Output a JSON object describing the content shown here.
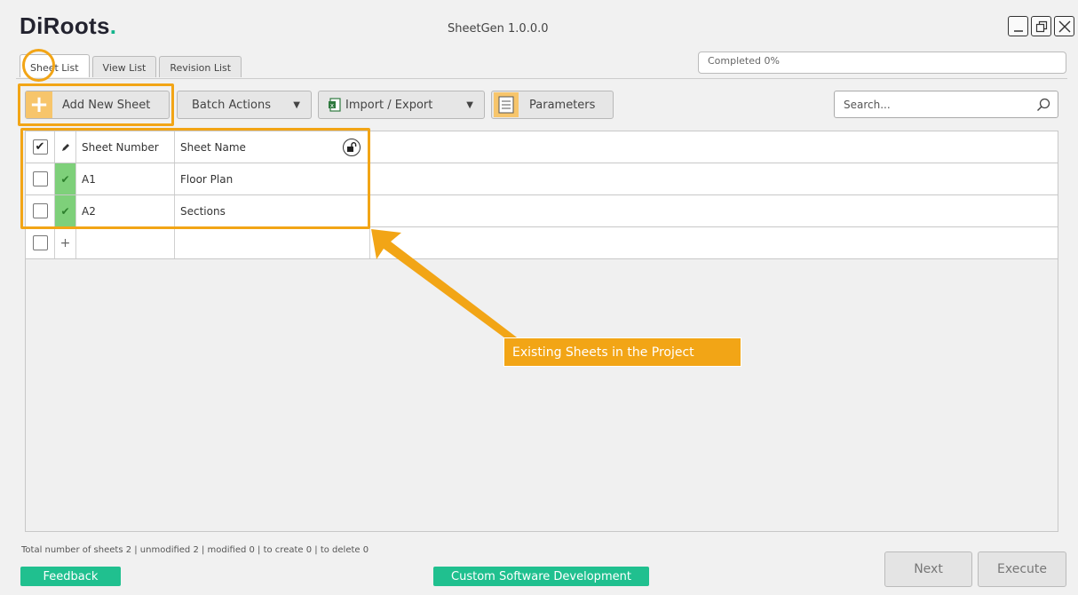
{
  "app": {
    "logo_main": "DiRoots",
    "logo_dot": ".",
    "title": "SheetGen 1.0.0.0"
  },
  "window_controls": {
    "minimize_icon": "minimize-icon",
    "restore_icon": "restore-icon",
    "close_icon": "close-icon"
  },
  "progress": {
    "label": "Completed 0%",
    "value": 0
  },
  "tabs": [
    {
      "label": "Sheet List",
      "active": true
    },
    {
      "label": "View List",
      "active": false
    },
    {
      "label": "Revision List",
      "active": false
    }
  ],
  "toolbar": {
    "add_label": "Add New Sheet",
    "batch_label": "Batch Actions",
    "import_label": "Import / Export",
    "params_label": "Parameters"
  },
  "search": {
    "placeholder": "Search..."
  },
  "grid": {
    "columns": {
      "number": "Sheet Number",
      "name": "Sheet Name"
    },
    "header_checked": true,
    "rows": [
      {
        "number": "A1",
        "name": "Floor Plan",
        "checked": false,
        "status": "unmodified"
      },
      {
        "number": "A2",
        "name": "Sections",
        "checked": false,
        "status": "unmodified"
      }
    ],
    "new_row_symbol": "+"
  },
  "callout": {
    "text": "Existing Sheets in the Project"
  },
  "status": {
    "text": "Total number of sheets 2 | unmodified 2 | modified 0 | to create 0 | to delete 0"
  },
  "footer": {
    "feedback_label": "Feedback",
    "custom_label": "Custom Software Development",
    "next_label": "Next",
    "execute_label": "Execute"
  },
  "colors": {
    "accent_orange": "#f2a516",
    "brand_green": "#20c08f",
    "tool_icon_bg": "#f7c56b",
    "modified_green": "#7ed07a"
  }
}
